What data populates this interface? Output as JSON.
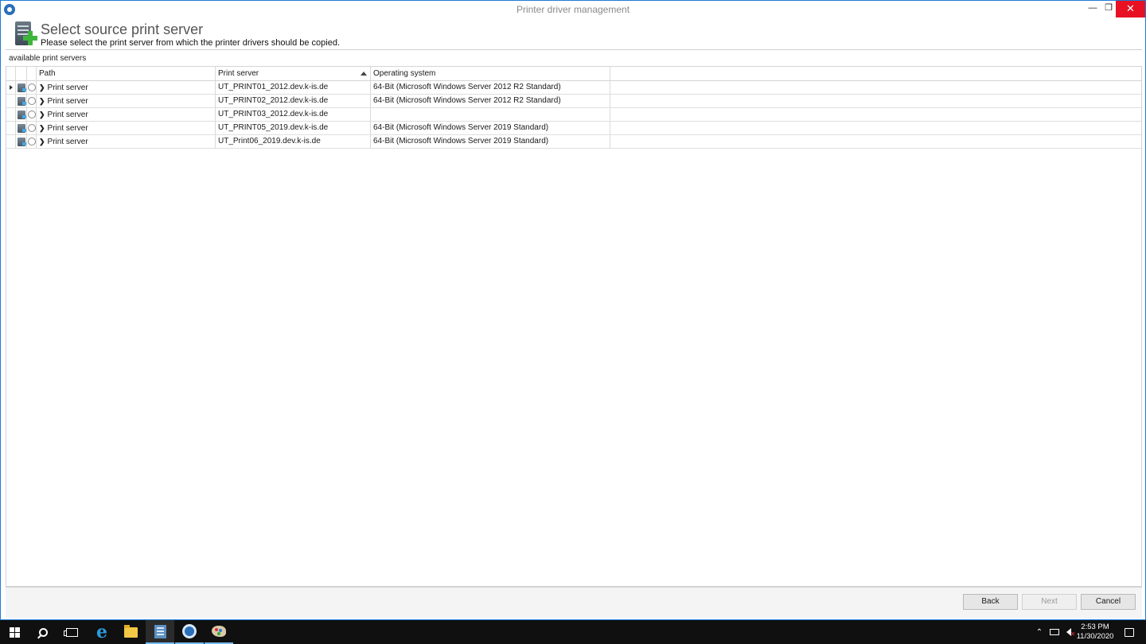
{
  "window": {
    "title": "Printer driver management",
    "minimize": "—",
    "restore": "❐",
    "close": "✕"
  },
  "header": {
    "title": "Select source print server",
    "subtitle": "Please select the print server from which the printer drivers should be copied.",
    "icon": "server-add-icon"
  },
  "group_label": "available print servers",
  "grid": {
    "columns": {
      "path": "Path",
      "print_server": "Print server",
      "os": "Operating system"
    },
    "sort": {
      "column": "Print server",
      "direction": "ascending"
    },
    "rows": [
      {
        "path": "Print server",
        "print_server": "UT_PRINT01_2012.dev.k-is.de",
        "os": "64-Bit (Microsoft Windows Server 2012 R2 Standard)"
      },
      {
        "path": "Print server",
        "print_server": "UT_PRINT02_2012.dev.k-is.de",
        "os": "64-Bit (Microsoft Windows Server 2012 R2 Standard)"
      },
      {
        "path": "Print server",
        "print_server": "UT_PRINT03_2012.dev.k-is.de",
        "os": ""
      },
      {
        "path": "Print server",
        "print_server": "UT_PRINT05_2019.dev.k-is.de",
        "os": "64-Bit (Microsoft Windows Server 2019 Standard)"
      },
      {
        "path": "Print server",
        "print_server": "UT_Print06_2019.dev.k-is.de",
        "os": "64-Bit (Microsoft Windows Server 2019 Standard)"
      }
    ]
  },
  "footer": {
    "back": "Back",
    "next": "Next",
    "cancel": "Cancel",
    "next_enabled": false
  },
  "taskbar": {
    "icons": [
      "windows-start-icon",
      "search-icon",
      "task-view-icon",
      "internet-explorer-icon",
      "file-explorer-icon",
      "printer-driver-app-icon",
      "settings-gear-app-icon",
      "paint-icon"
    ],
    "time": "2:53 PM",
    "date": "11/30/2020",
    "tray": [
      "show-hidden-icons-chevron",
      "network-icon",
      "volume-muted-icon",
      "action-center-icon"
    ]
  },
  "colors": {
    "accent": "#1e7bd6",
    "close_button": "#e81123",
    "taskbar": "#101010",
    "header_title": "#555555"
  }
}
